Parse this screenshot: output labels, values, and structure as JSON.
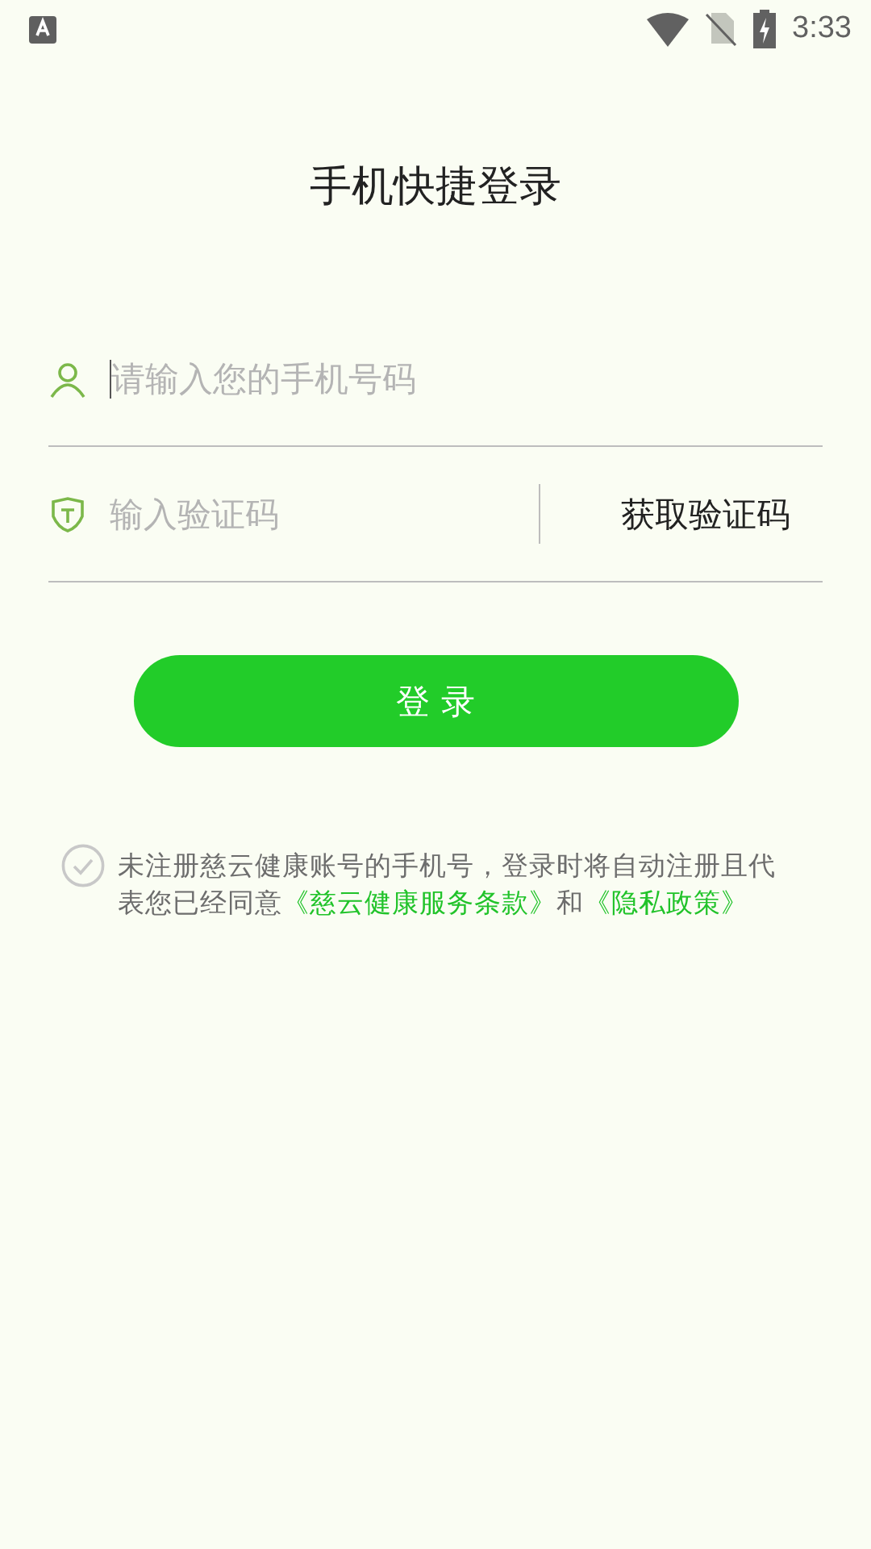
{
  "status_bar": {
    "time": "3:33"
  },
  "title": "手机快捷登录",
  "phone_field": {
    "placeholder": "请输入您的手机号码",
    "focused": true
  },
  "code_field": {
    "placeholder": "输入验证码"
  },
  "get_code_button": "获取验证码",
  "login_button": "登 录",
  "agreement": {
    "checked": false,
    "parts": [
      {
        "kind": "text",
        "text": "未注册慈云健康账号的手机号，登录时将自动注册且代表您已经同意"
      },
      {
        "kind": "link",
        "text": "《慈云健康服务条款》"
      },
      {
        "kind": "text",
        "text": "和"
      },
      {
        "kind": "link",
        "text": "《隐私政策》"
      }
    ]
  }
}
